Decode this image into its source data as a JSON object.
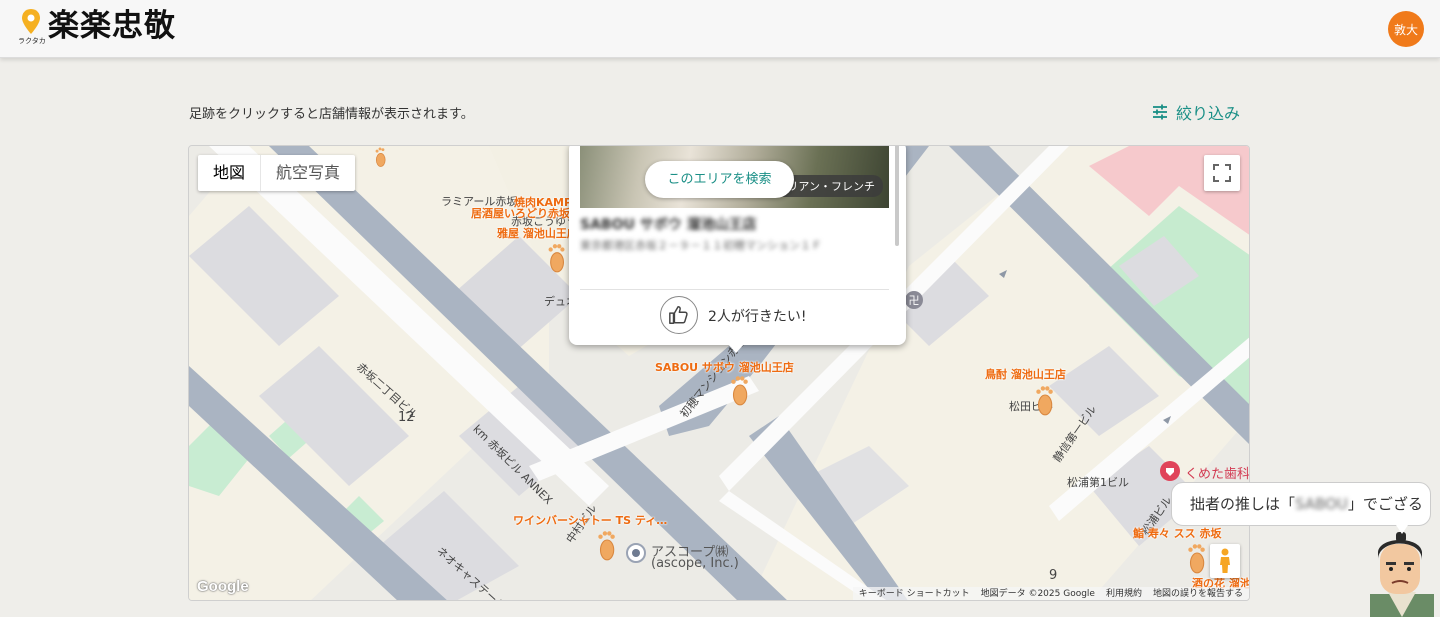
{
  "header": {
    "logo_kana": "ラクタカ",
    "logo_text": "楽楽忠敬",
    "avatar_text": "敦大"
  },
  "instruction": "足跡をクリックすると店舗情報が表示されます。",
  "filter_label": "絞り込み",
  "map": {
    "type_tabs": [
      "地図",
      "航空写真"
    ],
    "search_area_label": "このエリアを検索",
    "google_logo": "Google",
    "attribution": [
      "キーボード ショートカット",
      "地図データ ©2025 Google",
      "利用規約",
      "地図の誤りを報告する"
    ],
    "street_labels": {
      "ramiaru": "ラミアール赤坂",
      "akasaka_kou": "赤坂こうゆう",
      "dyu": "デュオ",
      "akasaka2": "赤坂二丁目ビル",
      "num12": "12",
      "km_annex": "km 赤坂ビル ANNEX",
      "hatsuho": "初穂マンション赤坂",
      "nakamura": "中村ビル",
      "neo": "ネオキャステール赤",
      "ascope": "アスコープ㈱",
      "ascope_en": "(ascope, Inc.)",
      "matsuda": "松田ビル",
      "seiho": "静信第一ビル",
      "matsuura1": "松浦第1ビル",
      "matsuura": "松浦ビル",
      "kumeta": "くめた歯科",
      "num9": "9"
    },
    "shop_labels": {
      "yakiniku": "焼肉KAMPO",
      "izakaya": "居酒屋いろどり赤坂",
      "gaya": "雅屋 溜池山王店",
      "sabou": "SABOU サボウ 溜池山王店",
      "torichu": "鳥酎 溜池山王店",
      "wine": "ワインバーシャトー TS ティ…",
      "sushi": "鮨 寿々 スス 赤坂",
      "hana": "酒の花 溜池"
    },
    "popup": {
      "genre": "イタリアン・フレンチ",
      "name": "SABOU サボウ 溜池山王店",
      "address": "東京都港区赤坂２－９－１１初穂マンション１Ｆ",
      "want_count_text": "2人が行きたい!"
    }
  },
  "bubble": {
    "prefix": "拙者の推しは「",
    "oshi": "SABOU",
    "suffix": "」でござる"
  },
  "colors": {
    "accent": "#1a8f86",
    "shop_label": "#ee6b11",
    "avatar": "#f07a1a"
  }
}
